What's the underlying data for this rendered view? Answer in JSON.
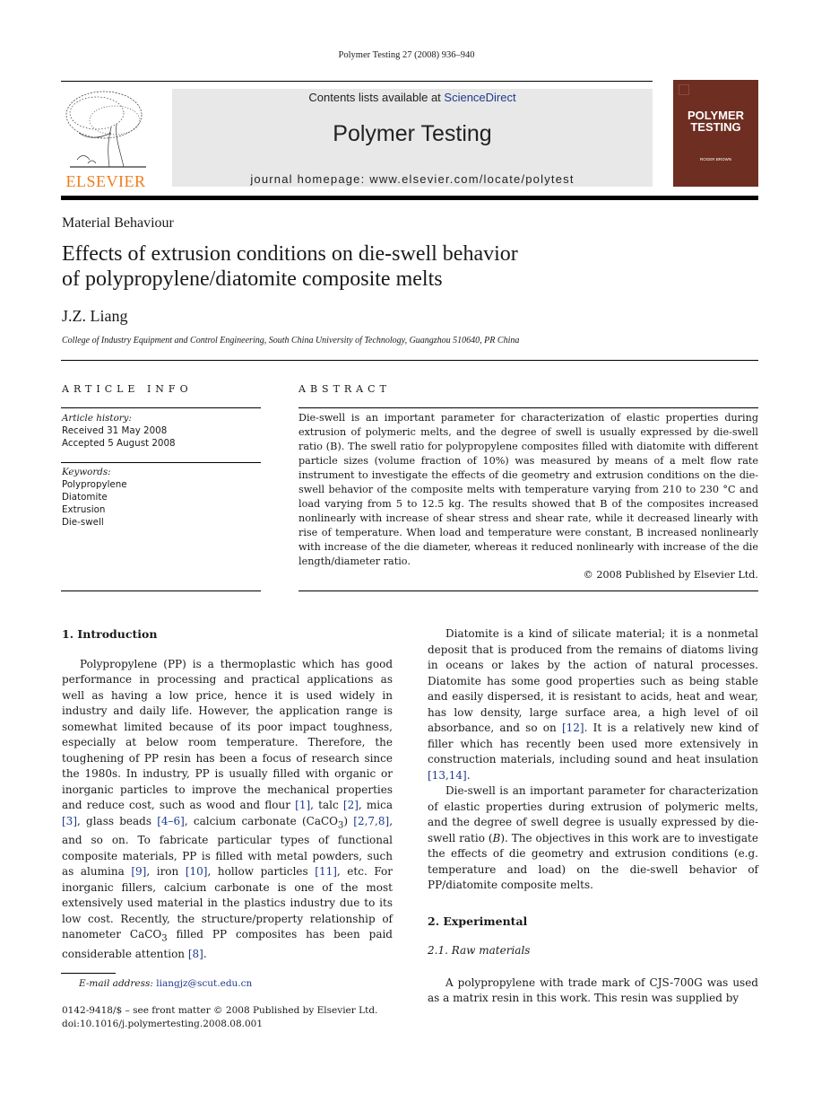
{
  "header": {
    "citation": "Polymer Testing 27 (2008) 936–940",
    "contents_prefix": "Contents lists available at ",
    "contents_link": "ScienceDirect",
    "journal_title": "Polymer Testing",
    "homepage": "journal homepage: www.elsevier.com/locate/polytest",
    "publisher_logo_text": "ELSEVIER",
    "cover_title_line1": "POLYMER",
    "cover_title_line2": "TESTING",
    "cover_editor": "ROGER BROWN"
  },
  "article": {
    "section": "Material Behaviour",
    "title_line1": "Effects of extrusion conditions on die-swell behavior",
    "title_line2": "of polypropylene/diatomite composite melts",
    "author": "J.Z. Liang",
    "affiliation": "College of Industry Equipment and Control Engineering, South China University of Technology, Guangzhou 510640, PR China"
  },
  "article_info": {
    "heading": "ARTICLE INFO",
    "history_label": "Article history:",
    "received": "Received 31 May 2008",
    "accepted": "Accepted 5 August 2008",
    "keywords_label": "Keywords:",
    "keywords": [
      "Polypropylene",
      "Diatomite",
      "Extrusion",
      "Die-swell"
    ]
  },
  "abstract": {
    "heading": "ABSTRACT",
    "text": "Die-swell is an important parameter for characterization of elastic properties during extrusion of polymeric melts, and the degree of swell is usually expressed by die-swell ratio (B). The swell ratio for polypropylene composites filled with diatomite with different particle sizes (volume fraction of 10%) was measured by means of a melt flow rate instrument to investigate the effects of die geometry and extrusion conditions on the die-swell behavior of the composite melts with temperature varying from 210 to 230 °C and load varying from 5 to 12.5 kg. The results showed that B of the composites increased nonlinearly with increase of shear stress and shear rate, while it decreased linearly with rise of temperature. When load and temperature were constant, B increased nonlinearly with increase of the die diameter, whereas it reduced nonlinearly with increase of the die length/diameter ratio.",
    "copyright": "© 2008 Published by Elsevier Ltd."
  },
  "body": {
    "intro_heading": "1.  Introduction",
    "intro_p1_a": "Polypropylene (PP) is a thermoplastic which has good performance in processing and practical applications as well as having a low price, hence it is used widely in industry and daily life. However, the application range is somewhat limited because of its poor impact toughness, especially at below room temperature. Therefore, the toughening of PP resin has been a focus of research since the 1980s. In industry, PP is usually filled with organic or inorganic particles to improve the mechanical properties and reduce cost, such as wood and flour ",
    "ref1": "[1]",
    "t1": ", talc ",
    "ref2": "[2]",
    "t2": ", mica ",
    "ref3": "[3]",
    "t3": ", glass beads ",
    "ref4": "[4–6]",
    "t4": ", calcium carbonate (CaCO",
    "sub3": "3",
    "t5": ") ",
    "ref5": "[2,7,8]",
    "t6": ", and so on. To fabricate particular types of functional composite materials, PP is filled with metal powders, such as alumina ",
    "ref6": "[9]",
    "t7": ", iron ",
    "ref7": "[10]",
    "t8": ", hollow particles ",
    "ref8": "[11]",
    "t9": ", etc. For inorganic fillers, calcium carbonate is one of the most extensively used material in the plastics industry due to its low cost. Recently, the structure/property relationship of nanometer CaCO",
    "sub3b": "3",
    "t10": " filled PP composites has been paid considerable attention ",
    "ref9": "[8]",
    "t11": ".",
    "diat_p_a": "Diatomite is a kind of silicate material; it is a nonmetal deposit that is produced from the remains of diatoms living in oceans or lakes by the action of natural processes. Diatomite has some good properties such as being stable and easily dispersed, it is resistant to acids, heat and wear, has low density, large surface area, a high level of oil absorbance, and so on ",
    "ref12": "[12]",
    "diat_p_b": ". It is a relatively new kind of filler which has recently been used more extensively in construction materials, including sound and heat insulation ",
    "ref13": "[13,14]",
    "diat_p_c": ".",
    "dieswell_p_a": "Die-swell is an important parameter for characterization of elastic properties during extrusion of polymeric melts, and the degree of swell degree is usually expressed by die-swell ratio (",
    "dieswell_B": "B",
    "dieswell_p_b": "). The objectives in this work are to investigate the effects of die geometry and extrusion conditions (e.g. temperature and load) on the die-swell behavior of PP/diatomite composite melts.",
    "exp_heading": "2.  Experimental",
    "raw_heading": "2.1.  Raw materials",
    "raw_p": "A polypropylene with trade mark of CJS-700G was used as a matrix resin in this work. This resin was supplied by"
  },
  "footer": {
    "email_label": "E-mail address: ",
    "email": "liangjz@scut.edu.cn",
    "front_matter": "0142-9418/$ – see front matter © 2008 Published by Elsevier Ltd.",
    "doi": "doi:10.1016/j.polymertesting.2008.08.001"
  }
}
